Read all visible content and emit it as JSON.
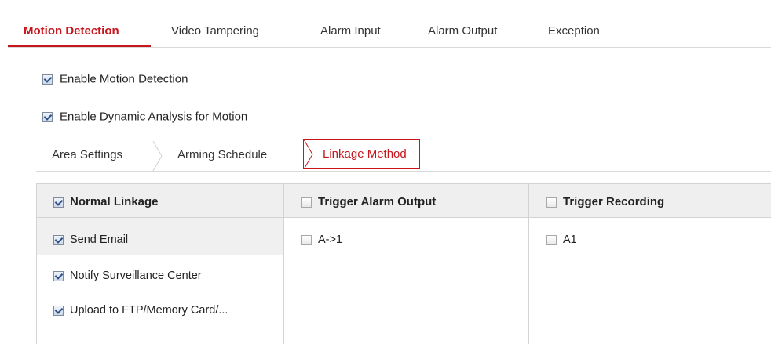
{
  "tabs": [
    {
      "label": "Motion Detection",
      "active": true
    },
    {
      "label": "Video Tampering",
      "active": false
    },
    {
      "label": "Alarm Input",
      "active": false
    },
    {
      "label": "Alarm Output",
      "active": false
    },
    {
      "label": "Exception",
      "active": false
    }
  ],
  "options": {
    "enable_motion": {
      "label": "Enable Motion Detection",
      "checked": true
    },
    "enable_dynamic": {
      "label": "Enable Dynamic Analysis for Motion",
      "checked": true
    }
  },
  "subtabs": [
    {
      "label": "Area Settings",
      "active": false
    },
    {
      "label": "Arming Schedule",
      "active": false
    },
    {
      "label": "Linkage Method",
      "active": true
    }
  ],
  "linkage": {
    "normal": {
      "header": "Normal Linkage",
      "checked": true,
      "items": [
        {
          "label": "Send Email",
          "checked": true
        },
        {
          "label": "Notify Surveillance Center",
          "checked": true
        },
        {
          "label": "Upload to FTP/Memory Card/...",
          "checked": true
        }
      ]
    },
    "alarm_output": {
      "header": "Trigger Alarm Output",
      "checked": false,
      "items": [
        {
          "label": "A->1",
          "checked": false
        }
      ]
    },
    "recording": {
      "header": "Trigger Recording",
      "checked": false,
      "items": [
        {
          "label": "A1",
          "checked": false
        }
      ]
    }
  },
  "colors": {
    "accent": "#c8151b",
    "header_bg": "#efefef",
    "border": "#d3d3d3"
  }
}
